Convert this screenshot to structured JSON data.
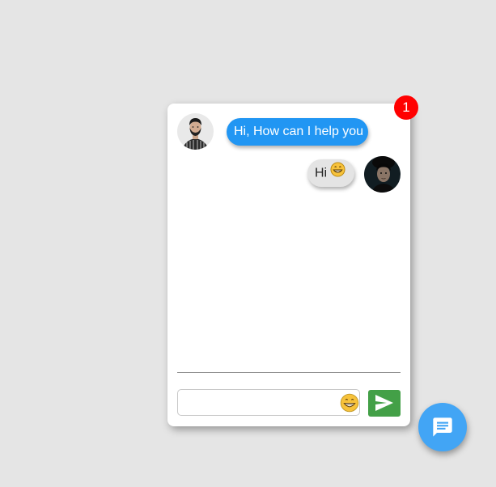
{
  "chat": {
    "unread_count": "1",
    "messages": [
      {
        "sender": "agent",
        "text": "Hi, How can I help you",
        "avatar_icon": "agent-avatar-icon"
      },
      {
        "sender": "user",
        "text": "Hi",
        "emoji": "grinning-face-icon",
        "avatar_icon": "user-avatar-icon"
      }
    ],
    "input": {
      "value": "",
      "placeholder": ""
    },
    "emoji_button_icon": "grinning-face-icon",
    "send_button_icon": "send-icon"
  },
  "launcher": {
    "icon": "chat-bubble-icon"
  },
  "colors": {
    "background": "#e5e5e5",
    "agent_bubble": "#2196f3",
    "user_bubble": "#e4e4e4",
    "badge": "#ff0000",
    "send_button": "#43a047",
    "launcher_button": "#42a5f5"
  }
}
